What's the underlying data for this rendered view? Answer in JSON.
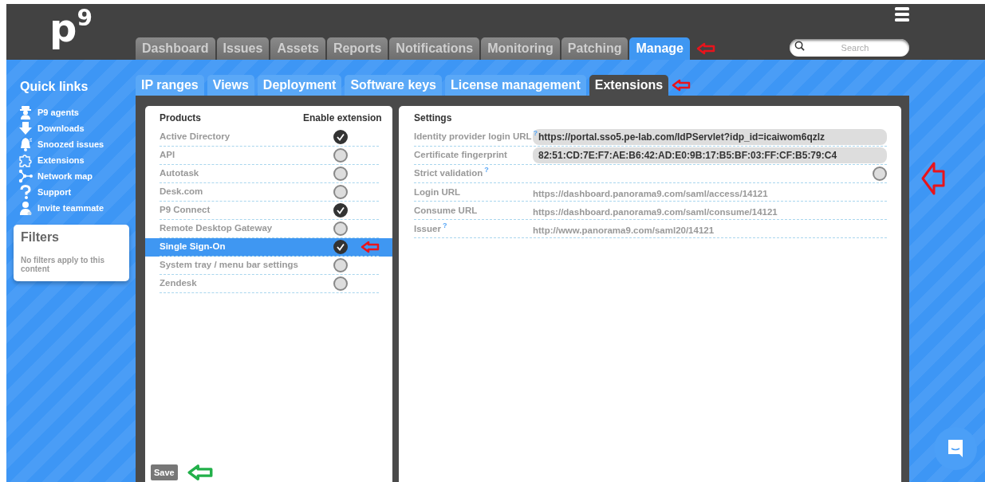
{
  "logo": "p$^{9}$",
  "nav_tabs": [
    {
      "label": "Dashboard",
      "selected": false
    },
    {
      "label": "Issues",
      "selected": false
    },
    {
      "label": "Assets",
      "selected": false
    },
    {
      "label": "Reports",
      "selected": false
    },
    {
      "label": "Notifications",
      "selected": false
    },
    {
      "label": "Monitoring",
      "selected": false
    },
    {
      "label": "Patching",
      "selected": false
    },
    {
      "label": "Manage",
      "selected": true
    }
  ],
  "search": {
    "placeholder": "Search"
  },
  "sub_tabs": [
    {
      "label": "IP ranges",
      "selected": false
    },
    {
      "label": "Views",
      "selected": false
    },
    {
      "label": "Deployment",
      "selected": false
    },
    {
      "label": "Software keys",
      "selected": false
    },
    {
      "label": "License management",
      "selected": false
    },
    {
      "label": "Extensions",
      "selected": true
    }
  ],
  "quick_links": {
    "title": "Quick links",
    "items": [
      {
        "label": "P9 agents",
        "kind": "agent"
      },
      {
        "label": "Downloads",
        "kind": "download"
      },
      {
        "label": "Snoozed issues",
        "kind": "bell"
      },
      {
        "label": "Extensions",
        "kind": "puzzle"
      },
      {
        "label": "Network map",
        "kind": "network"
      },
      {
        "label": "Support",
        "kind": "question"
      },
      {
        "label": "Invite teammate",
        "kind": "person"
      }
    ]
  },
  "filters": {
    "title": "Filters",
    "text": "No filters apply to this content"
  },
  "products": {
    "columns": [
      "Products",
      "Enable extension"
    ],
    "rows": [
      {
        "name": "Active Directory",
        "enabled": true,
        "selected": false
      },
      {
        "name": "API",
        "enabled": false,
        "selected": false
      },
      {
        "name": "Autotask",
        "enabled": false,
        "selected": false
      },
      {
        "name": "Desk.com",
        "enabled": false,
        "selected": false
      },
      {
        "name": "P9 Connect",
        "enabled": true,
        "selected": false
      },
      {
        "name": "Remote Desktop Gateway",
        "enabled": false,
        "selected": false
      },
      {
        "name": "Single Sign-On",
        "enabled": true,
        "selected": true
      },
      {
        "name": "System tray / menu bar settings",
        "enabled": false,
        "selected": false
      },
      {
        "name": "Zendesk",
        "enabled": false,
        "selected": false
      }
    ],
    "save_button": "Save"
  },
  "settings": {
    "title": "Settings",
    "rows": [
      {
        "label": "Identity provider login URL",
        "help": "?",
        "kind": "field",
        "value": "https://portal.sso5.pe-lab.com/IdPServlet?idp_id=icaiwom6qzlz"
      },
      {
        "label": "Certificate fingerprint",
        "kind": "field",
        "value": "82:51:CD:7E:F7:AE:B6:42:AD:E0:9B:17:B5:BF:03:FF:CF:B5:79:C4"
      },
      {
        "label": "Strict validation",
        "help": "?",
        "kind": "toggle",
        "on": false
      },
      {
        "label": "Login URL",
        "kind": "text",
        "value": "https://dashboard.panorama9.com/saml/access/14121"
      },
      {
        "label": "Consume URL",
        "kind": "text",
        "value": "https://dashboard.panorama9.com/saml/consume/14121"
      },
      {
        "label": "Issuer",
        "help": "?",
        "kind": "text",
        "value": "http://www.panorama9.com/saml20/14121"
      }
    ]
  }
}
